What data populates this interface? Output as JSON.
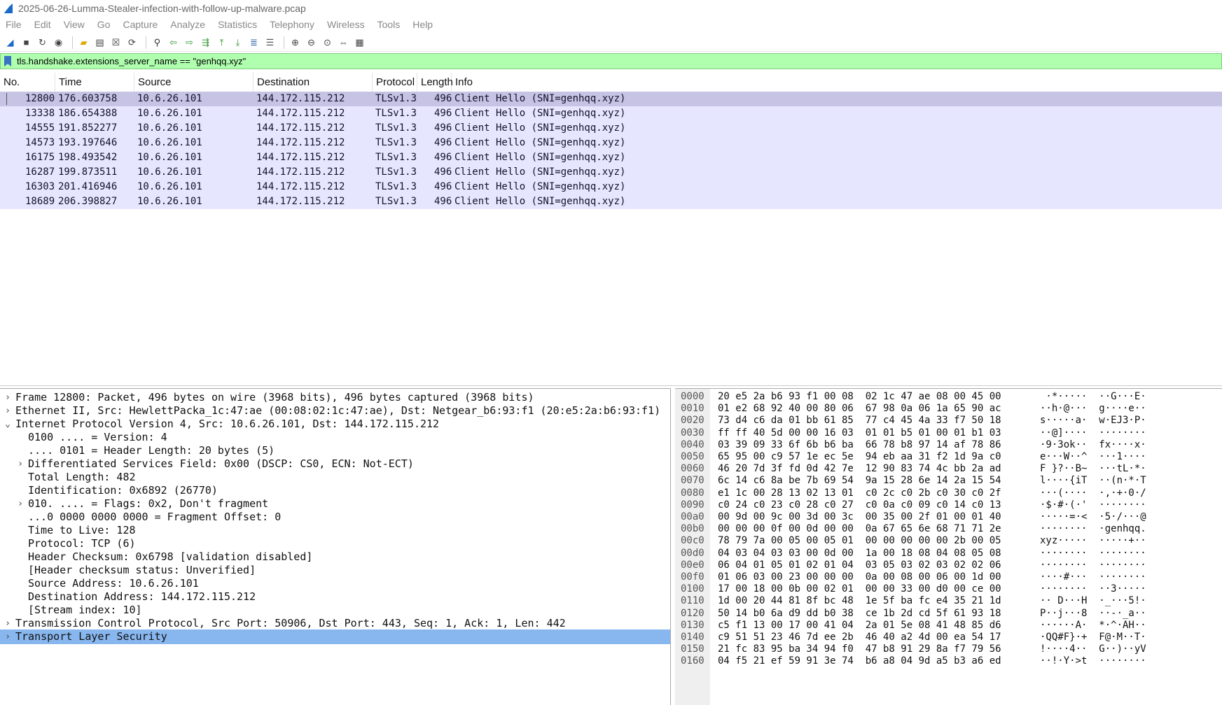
{
  "window": {
    "title": "2025-06-26-Lumma-Stealer-infection-with-follow-up-malware.pcap"
  },
  "menu": [
    "File",
    "Edit",
    "View",
    "Go",
    "Capture",
    "Analyze",
    "Statistics",
    "Telephony",
    "Wireless",
    "Tools",
    "Help"
  ],
  "toolbar": {
    "icons": [
      "shark-fin-icon",
      "stop-icon",
      "restart-icon",
      "gear-icon",
      "sep",
      "open-folder-icon",
      "save-icon",
      "close-file-icon",
      "reload-icon",
      "sep",
      "find-icon",
      "back-icon",
      "forward-icon",
      "goto-icon",
      "first-icon",
      "last-icon",
      "autoscroll-icon",
      "colorize-icon",
      "sep",
      "zoom-in-icon",
      "zoom-out-icon",
      "zoom-reset-icon",
      "resize-columns-icon",
      "grid-icon"
    ]
  },
  "filter": {
    "value": "tls.handshake.extensions_server_name == \"genhqq.xyz\""
  },
  "packet_list": {
    "columns": [
      "No.",
      "Time",
      "Source",
      "Destination",
      "Protocol",
      "Length",
      "Info"
    ],
    "rows": [
      {
        "no": "12800",
        "time": "176.603758",
        "src": "10.6.26.101",
        "dst": "144.172.115.212",
        "proto": "TLSv1.3",
        "len": "496",
        "info": "Client Hello (SNI=genhqq.xyz)"
      },
      {
        "no": "13338",
        "time": "186.654388",
        "src": "10.6.26.101",
        "dst": "144.172.115.212",
        "proto": "TLSv1.3",
        "len": "496",
        "info": "Client Hello (SNI=genhqq.xyz)"
      },
      {
        "no": "14555",
        "time": "191.852277",
        "src": "10.6.26.101",
        "dst": "144.172.115.212",
        "proto": "TLSv1.3",
        "len": "496",
        "info": "Client Hello (SNI=genhqq.xyz)"
      },
      {
        "no": "14573",
        "time": "193.197646",
        "src": "10.6.26.101",
        "dst": "144.172.115.212",
        "proto": "TLSv1.3",
        "len": "496",
        "info": "Client Hello (SNI=genhqq.xyz)"
      },
      {
        "no": "16175",
        "time": "198.493542",
        "src": "10.6.26.101",
        "dst": "144.172.115.212",
        "proto": "TLSv1.3",
        "len": "496",
        "info": "Client Hello (SNI=genhqq.xyz)"
      },
      {
        "no": "16287",
        "time": "199.873511",
        "src": "10.6.26.101",
        "dst": "144.172.115.212",
        "proto": "TLSv1.3",
        "len": "496",
        "info": "Client Hello (SNI=genhqq.xyz)"
      },
      {
        "no": "16303",
        "time": "201.416946",
        "src": "10.6.26.101",
        "dst": "144.172.115.212",
        "proto": "TLSv1.3",
        "len": "496",
        "info": "Client Hello (SNI=genhqq.xyz)"
      },
      {
        "no": "18689",
        "time": "206.398827",
        "src": "10.6.26.101",
        "dst": "144.172.115.212",
        "proto": "TLSv1.3",
        "len": "496",
        "info": "Client Hello (SNI=genhqq.xyz)"
      }
    ]
  },
  "details": [
    {
      "arrow": "right",
      "indent": 0,
      "text": "Frame 12800: Packet, 496 bytes on wire (3968 bits), 496 bytes captured (3968 bits)"
    },
    {
      "arrow": "right",
      "indent": 0,
      "text": "Ethernet II, Src: HewlettPacka_1c:47:ae (00:08:02:1c:47:ae), Dst: Netgear_b6:93:f1 (20:e5:2a:b6:93:f1)"
    },
    {
      "arrow": "down",
      "indent": 0,
      "text": "Internet Protocol Version 4, Src: 10.6.26.101, Dst: 144.172.115.212"
    },
    {
      "arrow": "",
      "indent": 1,
      "text": "0100 .... = Version: 4"
    },
    {
      "arrow": "",
      "indent": 1,
      "text": ".... 0101 = Header Length: 20 bytes (5)"
    },
    {
      "arrow": "right",
      "indent": 1,
      "text": "Differentiated Services Field: 0x00 (DSCP: CS0, ECN: Not-ECT)"
    },
    {
      "arrow": "",
      "indent": 1,
      "text": "Total Length: 482"
    },
    {
      "arrow": "",
      "indent": 1,
      "text": "Identification: 0x6892 (26770)"
    },
    {
      "arrow": "right",
      "indent": 1,
      "text": "010. .... = Flags: 0x2, Don't fragment"
    },
    {
      "arrow": "",
      "indent": 1,
      "text": "...0 0000 0000 0000 = Fragment Offset: 0"
    },
    {
      "arrow": "",
      "indent": 1,
      "text": "Time to Live: 128"
    },
    {
      "arrow": "",
      "indent": 1,
      "text": "Protocol: TCP (6)"
    },
    {
      "arrow": "",
      "indent": 1,
      "text": "Header Checksum: 0x6798 [validation disabled]"
    },
    {
      "arrow": "",
      "indent": 1,
      "text": "[Header checksum status: Unverified]"
    },
    {
      "arrow": "",
      "indent": 1,
      "text": "Source Address: 10.6.26.101"
    },
    {
      "arrow": "",
      "indent": 1,
      "text": "Destination Address: 144.172.115.212"
    },
    {
      "arrow": "",
      "indent": 1,
      "text": "[Stream index: 10]"
    },
    {
      "arrow": "right",
      "indent": 0,
      "text": "Transmission Control Protocol, Src Port: 50906, Dst Port: 443, Seq: 1, Ack: 1, Len: 442"
    },
    {
      "arrow": "right",
      "indent": 0,
      "text": "Transport Layer Security",
      "selected": true
    }
  ],
  "bytes": [
    {
      "off": "0000",
      "hex": "20 e5 2a b6 93 f1 00 08  02 1c 47 ae 08 00 45 00",
      "asc": " ·*·····  ··G···E·"
    },
    {
      "off": "0010",
      "hex": "01 e2 68 92 40 00 80 06  67 98 0a 06 1a 65 90 ac",
      "asc": "··h·@···  g····e··"
    },
    {
      "off": "0020",
      "hex": "73 d4 c6 da 01 bb 61 85  77 c4 45 4a 33 f7 50 18",
      "asc": "s·····a·  w·EJ3·P·"
    },
    {
      "off": "0030",
      "hex": "ff ff 40 5d 00 00 16 03  01 01 b5 01 00 01 b1 03",
      "asc": "··@]····  ········"
    },
    {
      "off": "0040",
      "hex": "03 39 09 33 6f 6b b6 ba  66 78 b8 97 14 af 78 86",
      "asc": "·9·3ok··  fx····x·"
    },
    {
      "off": "0050",
      "hex": "65 95 00 c9 57 1e ec 5e  94 eb aa 31 f2 1d 9a c0",
      "asc": "e···W··^  ···1····"
    },
    {
      "off": "0060",
      "hex": "46 20 7d 3f fd 0d 42 7e  12 90 83 74 4c bb 2a ad",
      "asc": "F }?··B~  ···tL·*·"
    },
    {
      "off": "0070",
      "hex": "6c 14 c6 8a be 7b 69 54  9a 15 28 6e 14 2a 15 54",
      "asc": "l····{iT  ··(n·*·T"
    },
    {
      "off": "0080",
      "hex": "e1 1c 00 28 13 02 13 01  c0 2c c0 2b c0 30 c0 2f",
      "asc": "···(····  ·,·+·0·/"
    },
    {
      "off": "0090",
      "hex": "c0 24 c0 23 c0 28 c0 27  c0 0a c0 09 c0 14 c0 13",
      "asc": "·$·#·(·'  ········"
    },
    {
      "off": "00a0",
      "hex": "00 9d 00 9c 00 3d 00 3c  00 35 00 2f 01 00 01 40",
      "asc": "·····=·<  ·5·/···@"
    },
    {
      "off": "00b0",
      "hex": "00 00 00 0f 00 0d 00 00  0a 67 65 6e 68 71 71 2e",
      "asc": "········  ·genhqq."
    },
    {
      "off": "00c0",
      "hex": "78 79 7a 00 05 00 05 01  00 00 00 00 00 2b 00 05",
      "asc": "xyz·····  ·····+··"
    },
    {
      "off": "00d0",
      "hex": "04 03 04 03 03 00 0d 00  1a 00 18 08 04 08 05 08",
      "asc": "········  ········"
    },
    {
      "off": "00e0",
      "hex": "06 04 01 05 01 02 01 04  03 05 03 02 03 02 02 06",
      "asc": "········  ········"
    },
    {
      "off": "00f0",
      "hex": "01 06 03 00 23 00 00 00  0a 00 08 00 06 00 1d 00",
      "asc": "····#···  ········"
    },
    {
      "off": "0100",
      "hex": "17 00 18 00 0b 00 02 01  00 00 33 00 d0 00 ce 00",
      "asc": "········  ··3·····"
    },
    {
      "off": "0110",
      "hex": "1d 00 20 44 81 8f bc 48  1e 5f ba fc e4 35 21 1d",
      "asc": "·· D···H  ·_···5!·"
    },
    {
      "off": "0120",
      "hex": "50 14 b0 6a d9 dd b0 38  ce 1b 2d cd 5f 61 93 18",
      "asc": "P··j···8  ··-·_a··"
    },
    {
      "off": "0130",
      "hex": "c5 f1 13 00 17 00 41 04  2a 01 5e 08 41 48 85 d6",
      "asc": "······A·  *·^·AH··"
    },
    {
      "off": "0140",
      "hex": "c9 51 51 23 46 7d ee 2b  46 40 a2 4d 00 ea 54 17",
      "asc": "·QQ#F}·+  F@·M··T·"
    },
    {
      "off": "0150",
      "hex": "21 fc 83 95 ba 34 94 f0  47 b8 91 29 8a f7 79 56",
      "asc": "!····4··  G··)··yV"
    },
    {
      "off": "0160",
      "hex": "04 f5 21 ef 59 91 3e 74  b6 a8 04 9d a5 b3 a6 ed",
      "asc": "··!·Y·>t  ········"
    }
  ]
}
